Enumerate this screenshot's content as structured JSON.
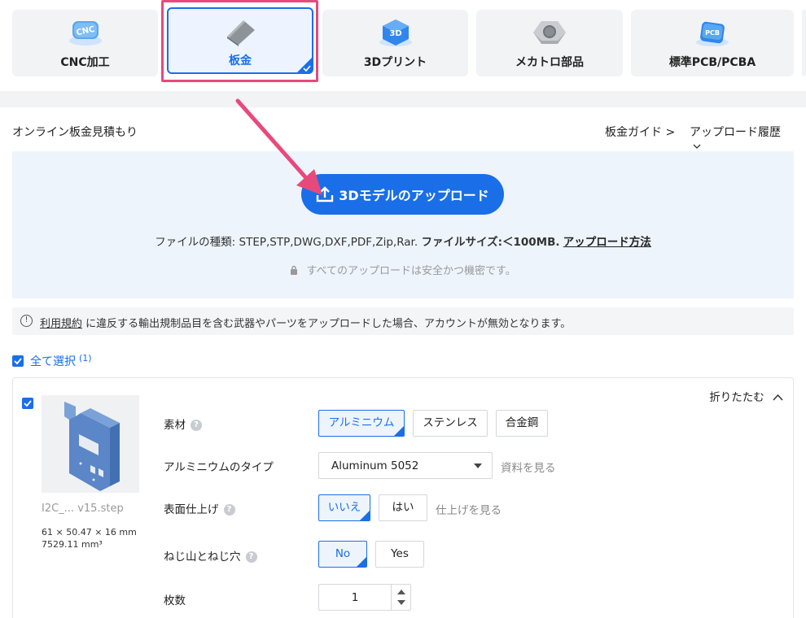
{
  "services": [
    {
      "label": "CNC加工",
      "icon": "cnc-icon",
      "active": false
    },
    {
      "label": "板金",
      "icon": "sheet-metal-icon",
      "active": true
    },
    {
      "label": "3Dプリント",
      "icon": "3d-print-icon",
      "active": false
    },
    {
      "label": "メカトロ部品",
      "icon": "nut-icon",
      "active": false
    },
    {
      "label": "標準PCB/PCBA",
      "icon": "pcb-icon",
      "active": false
    }
  ],
  "header": {
    "title": "オンライン板金見積もり",
    "guide": "板金ガイド >",
    "history": "アップロード履歴"
  },
  "upload": {
    "button_label": "3Dモデルのアップロード",
    "file_types": "ファイルの種類: STEP,STP,DWG,DXF,PDF,Zip,Rar.",
    "file_size": "ファイルサイズ:＜100MB.",
    "how_to": "アップロード方法",
    "secure_note": "すべてのアップロードは安全かつ機密です。"
  },
  "notice": {
    "terms": "利用規約",
    "text": " に違反する輸出規制品目を含む武器やパーツをアップロードした場合、アカウントが無効となります。"
  },
  "select_all": {
    "label": "全て選択",
    "count": "(1)"
  },
  "part": {
    "file_name": "I2C_... v15.step",
    "dimensions": "61 × 50.47 × 16 mm",
    "volume": "7529.11 mm³",
    "collapse": "折りたたむ",
    "material": {
      "label": "素材",
      "options": [
        "アルミニウム",
        "ステンレス",
        "合金鋼"
      ]
    },
    "aluminum_type": {
      "label": "アルミニウムのタイプ",
      "value": "Aluminum 5052",
      "link": "資料を見る"
    },
    "finish": {
      "label": "表面仕上げ",
      "options": [
        "いいえ",
        "はい"
      ],
      "link": "仕上げを見る"
    },
    "threads": {
      "label": "ねじ山とねじ穴",
      "options": [
        "No",
        "Yes"
      ]
    },
    "quantity": {
      "label": "枚数",
      "value": "1"
    }
  },
  "colors": {
    "accent": "#1a6fe8",
    "highlight": "#e8497b"
  }
}
